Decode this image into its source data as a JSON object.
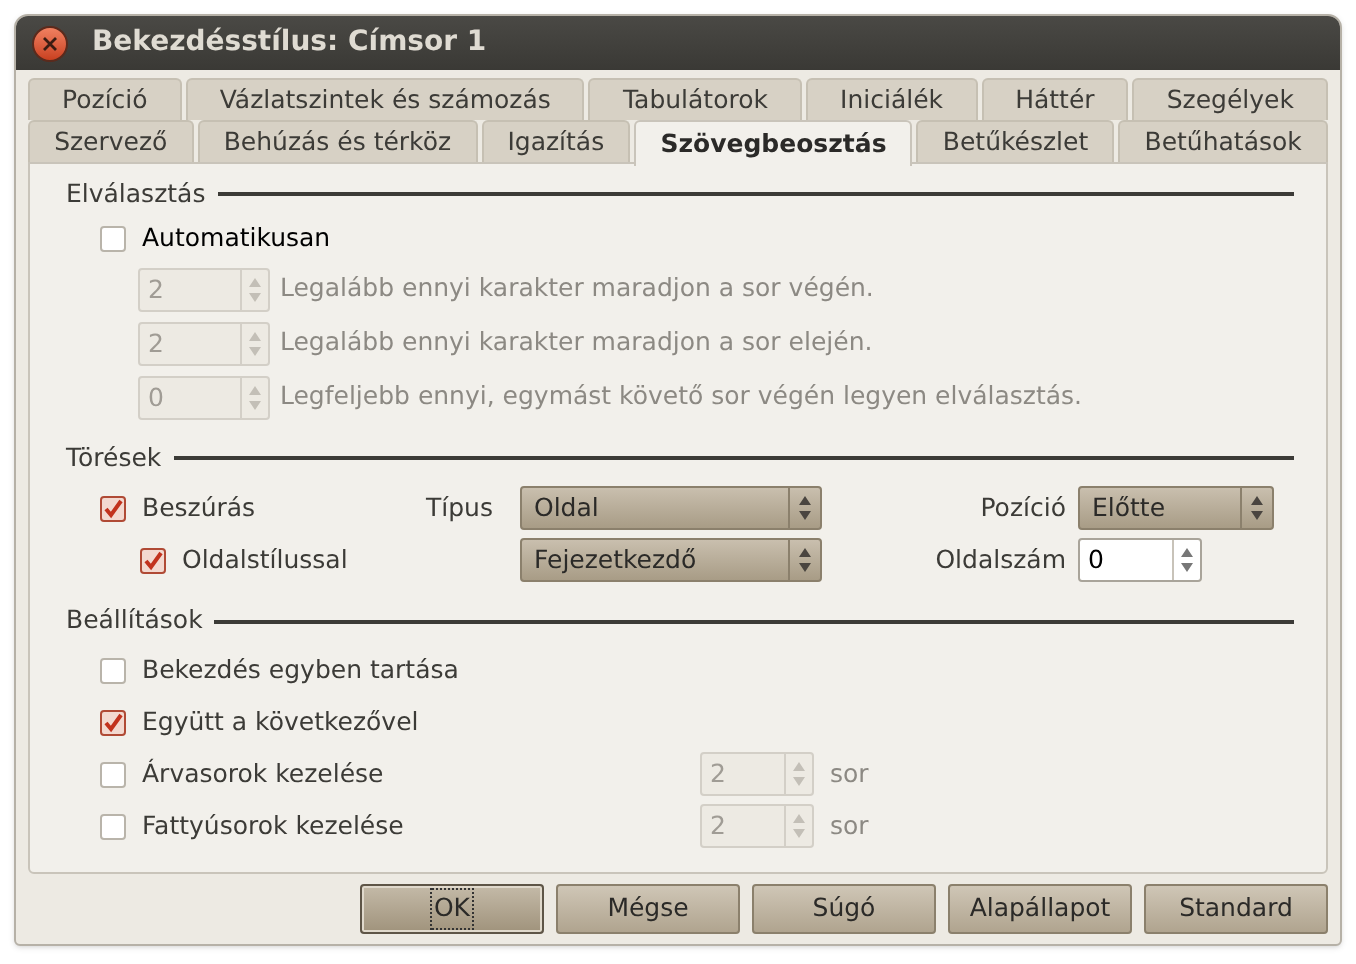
{
  "window": {
    "title": "Bekezdésstílus: Címsor 1"
  },
  "tab_rows": [
    [
      {
        "label": "Pozíció",
        "selected": false
      },
      {
        "label": "Vázlatszintek és számozás",
        "selected": false
      },
      {
        "label": "Tabulátorok",
        "selected": false
      },
      {
        "label": "Iniciálék",
        "selected": false
      },
      {
        "label": "Háttér",
        "selected": false
      },
      {
        "label": "Szegélyek",
        "selected": false
      }
    ],
    [
      {
        "label": "Szervező",
        "selected": false
      },
      {
        "label": "Behúzás és térköz",
        "selected": false
      },
      {
        "label": "Igazítás",
        "selected": false
      },
      {
        "label": "Szövegbeosztás",
        "selected": true
      },
      {
        "label": "Betűkészlet",
        "selected": false
      },
      {
        "label": "Betűhatások",
        "selected": false
      }
    ]
  ],
  "hyphenation": {
    "title": "Elválasztás",
    "auto": {
      "label": "Automatikusan",
      "checked": false
    },
    "spins": [
      {
        "value": "2",
        "label": "Legalább ennyi karakter maradjon a sor végén.",
        "disabled": true
      },
      {
        "value": "2",
        "label": "Legalább ennyi karakter maradjon a sor elején.",
        "disabled": true
      },
      {
        "value": "0",
        "label": "Legfeljebb ennyi, egymást követő sor végén legyen elválasztás.",
        "disabled": true
      }
    ]
  },
  "breaks": {
    "title": "Törések",
    "insert": {
      "label": "Beszúrás",
      "checked": true
    },
    "type_label": "Típus",
    "type_value": "Oldal",
    "position_label": "Pozíció",
    "position_value": "Előtte",
    "with_page_style": {
      "label": "Oldalstílussal",
      "checked": true
    },
    "page_style_value": "Fejezetkezdő",
    "page_number_label": "Oldalszám",
    "page_number_value": "0"
  },
  "options": {
    "title": "Beállítások",
    "items": [
      {
        "kind": "check",
        "label": "Bekezdés egyben tartása",
        "checked": false
      },
      {
        "kind": "check",
        "label": "Együtt a következővel",
        "checked": true
      },
      {
        "kind": "check_spin",
        "label": "Árvasorok kezelése",
        "checked": false,
        "value": "2",
        "unit": "sor",
        "disabled": true
      },
      {
        "kind": "check_spin",
        "label": "Fattyúsorok kezelése",
        "checked": false,
        "value": "2",
        "unit": "sor",
        "disabled": true
      }
    ]
  },
  "buttons": [
    {
      "label": "OK",
      "focused": true
    },
    {
      "label": "Mégse",
      "focused": false
    },
    {
      "label": "Súgó",
      "focused": false
    },
    {
      "label": "Alapállapot",
      "focused": false
    },
    {
      "label": "Standard",
      "focused": false
    }
  ]
}
